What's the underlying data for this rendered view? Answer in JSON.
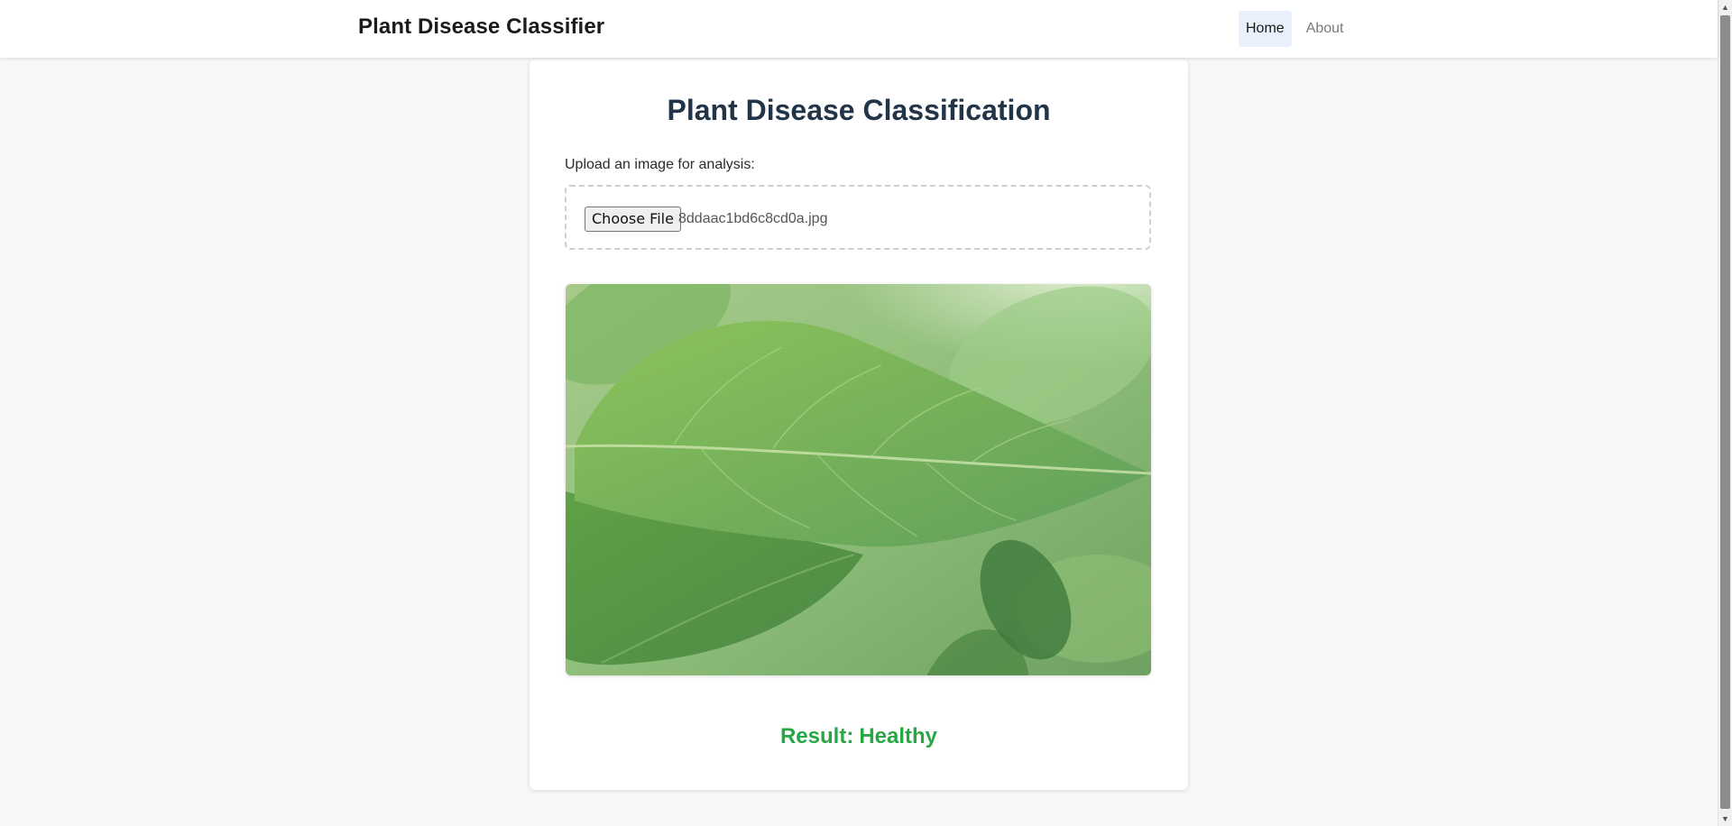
{
  "navbar": {
    "brand": "Plant Disease Classifier",
    "links": [
      {
        "label": "Home",
        "active": true
      },
      {
        "label": "About",
        "active": false
      }
    ]
  },
  "card": {
    "title": "Plant Disease Classification",
    "upload_label": "Upload an image for analysis:",
    "file_button_label": "Choose File",
    "file_name": "8ddaac1bd6c8cd0a.jpg",
    "result_label": "Result:",
    "result_value": "Healthy",
    "result_color": "#28a745"
  },
  "colors": {
    "background": "#f8f8f8",
    "title": "#223548",
    "active_nav_bg": "#e8f1fb"
  },
  "icons": {
    "scroll_up": "scroll-up-arrow-icon",
    "scroll_down": "scroll-down-arrow-icon"
  }
}
